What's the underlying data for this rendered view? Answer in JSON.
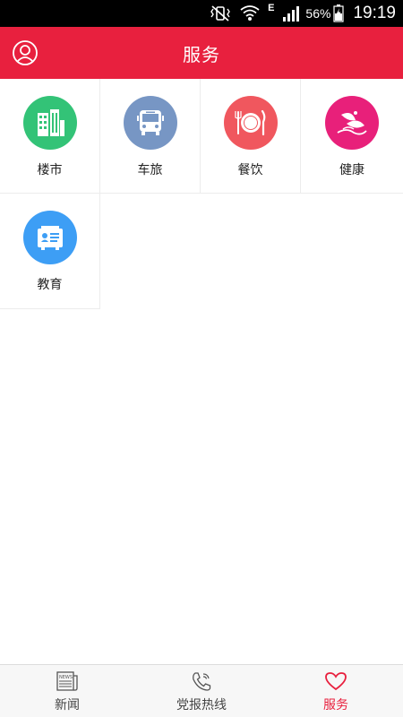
{
  "status_bar": {
    "network_type": "E",
    "battery": "56%",
    "time": "19:19",
    "icons": [
      "mute-vibrate-icon",
      "wifi-icon",
      "signal-icon",
      "battery-icon"
    ]
  },
  "header": {
    "title": "服务",
    "color": "#e8203e",
    "left_icon": "profile-icon"
  },
  "services": [
    {
      "label": "楼市",
      "icon": "buildings-icon",
      "color": "#33c377"
    },
    {
      "label": "车旅",
      "icon": "bus-icon",
      "color": "#7796c4"
    },
    {
      "label": "餐饮",
      "icon": "plate-cutlery-icon",
      "color": "#f0575e"
    },
    {
      "label": "健康",
      "icon": "flower-icon",
      "color": "#e8207a"
    },
    {
      "label": "教育",
      "icon": "certificate-icon",
      "color": "#3d9ef5"
    }
  ],
  "bottom_nav": {
    "items": [
      {
        "label": "新闻",
        "icon": "news-icon",
        "active": false
      },
      {
        "label": "党报热线",
        "icon": "phone-icon",
        "active": false
      },
      {
        "label": "服务",
        "icon": "heart-icon",
        "active": true
      }
    ],
    "active_color": "#e8203e"
  }
}
